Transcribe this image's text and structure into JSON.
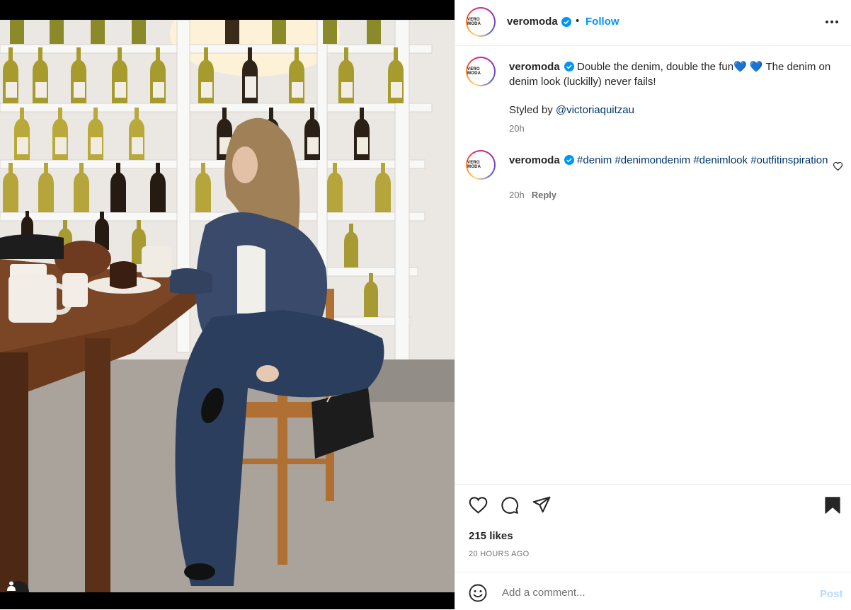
{
  "post": {
    "author": "veromoda",
    "avatar_logo": "VERO MODA",
    "verified": true,
    "header_separator": "•",
    "follow_label": "Follow",
    "more_icon": "more-horizontal-icon"
  },
  "caption": {
    "username": "veromoda",
    "text_line": "Double the denim, double the fun💙 💙  The denim on denim look (luckilly) never fails!",
    "styled_prefix": "Styled by ",
    "styled_mention": "@victoriaquitzau",
    "time": "20h"
  },
  "comment": {
    "username": "veromoda",
    "hashtags": "#denim #denimondenim #denimlook #outfitinspiration",
    "time": "20h",
    "reply_label": "Reply",
    "like_icon": "heart-icon"
  },
  "actions": {
    "like_icon": "heart-icon",
    "comment_icon": "comment-bubble-icon",
    "share_icon": "paper-plane-icon",
    "save_icon": "bookmark-icon",
    "likes_text": "215 likes",
    "timestamp": "20 HOURS AGO"
  },
  "add_comment": {
    "placeholder": "Add a comment...",
    "post_label": "Post",
    "emoji_icon": "smiley-icon"
  },
  "media": {
    "tag_icon": "user-tag-icon"
  },
  "colors": {
    "link": "#0095f6",
    "mention": "#00376b",
    "muted": "#737373",
    "post_disabled": "#b3dbff"
  }
}
